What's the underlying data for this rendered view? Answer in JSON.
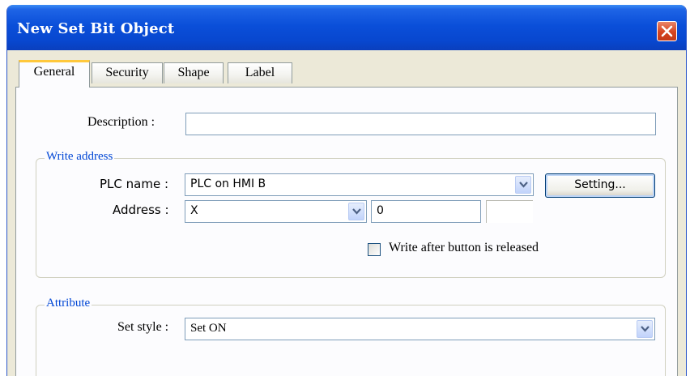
{
  "window": {
    "title": "New  Set Bit Object"
  },
  "tabs": [
    {
      "label": "General",
      "active": true
    },
    {
      "label": "Security",
      "active": false
    },
    {
      "label": "Shape",
      "active": false
    },
    {
      "label": "Label",
      "active": false
    }
  ],
  "general": {
    "description_label": "Description :",
    "description_value": "",
    "write_address": {
      "group_title": "Write address",
      "plc_name_label": "PLC name :",
      "plc_name_value": "PLC on HMI B",
      "setting_button": "Setting...",
      "address_label": "Address :",
      "address_type_value": "X",
      "address_number_value": "0",
      "address_extra_value": "",
      "write_after_release_label": "Write after button is released",
      "write_after_release_checked": false
    },
    "attribute": {
      "group_title": "Attribute",
      "set_style_label": "Set style :",
      "set_style_value": "Set ON"
    }
  },
  "icons": {
    "close": "close-icon",
    "dropdown": "chevron-down-icon"
  },
  "colors": {
    "titlebar": "#0a4fd9",
    "close_button": "#d6441f",
    "group_title": "#0046d5",
    "active_tab_highlight": "#ffc83c"
  }
}
